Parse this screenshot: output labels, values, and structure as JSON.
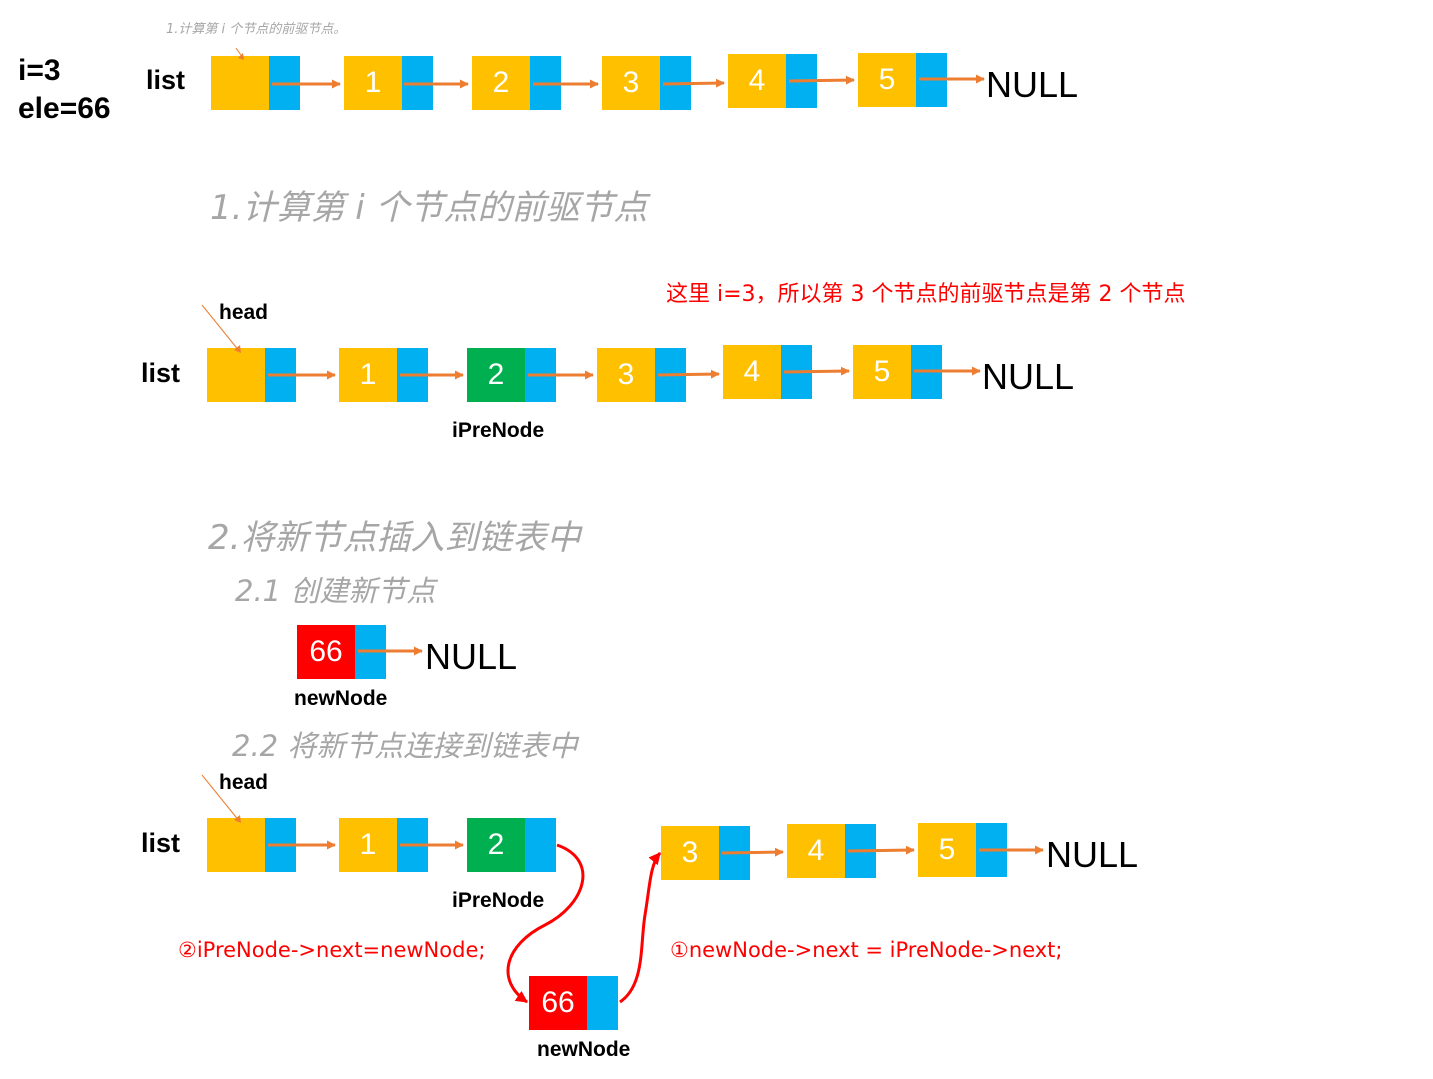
{
  "params": {
    "i_label": "i=3",
    "ele_label": "ele=66"
  },
  "labels": {
    "list": "list",
    "head": "head",
    "null": "NULL",
    "ipre": "iPreNode",
    "newnode": "newNode"
  },
  "headings": {
    "tiny": "1.计算第 i 个节点的前驱节点。",
    "step1": "1.计算第 i 个节点的前驱节点",
    "step2": "2.将新节点插入到链表中",
    "step2_1": "2.1 创建新节点",
    "step2_2": "2.2 将新节点连接到链表中"
  },
  "notes": {
    "explain": "这里 i=3，所以第 3 个节点的前驱节点是第 2 个节点",
    "step_b": "②iPreNode->next=newNode;",
    "step_a": "①newNode->next = iPreNode->next;"
  },
  "node_values": {
    "n1": "1",
    "n2": "2",
    "n3": "3",
    "n4": "4",
    "n5": "5",
    "new": "66"
  },
  "colors": {
    "node": "#ffc000",
    "pointer": "#00b0f0",
    "prev_node": "#00b050",
    "new_node": "#ff0000",
    "arrow": "#ed7d31",
    "curve": "#ff0000"
  }
}
